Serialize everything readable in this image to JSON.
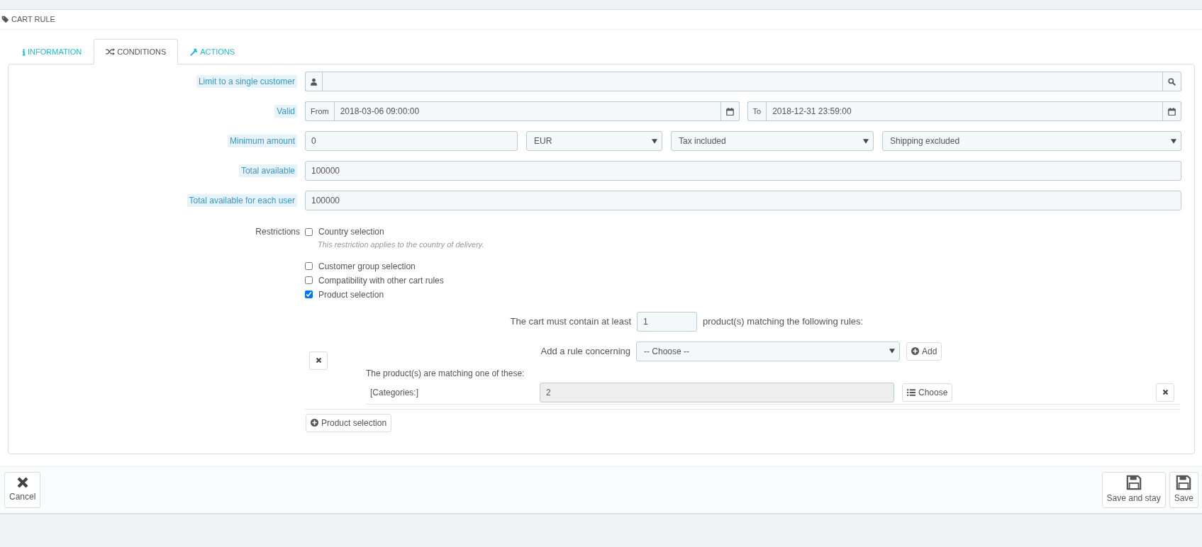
{
  "header": {
    "title": "CART RULE"
  },
  "tabs": [
    {
      "label": "INFORMATION",
      "selected": false
    },
    {
      "label": "CONDITIONS",
      "selected": true
    },
    {
      "label": "ACTIONS",
      "selected": false
    }
  ],
  "form": {
    "customer": {
      "label": "Limit to a single customer"
    },
    "valid": {
      "label": "Valid",
      "from_label": "From",
      "from_value": "2018-03-06 09:00:00",
      "to_label": "To",
      "to_value": "2018-12-31 23:59:00"
    },
    "minimum_amount": {
      "label": "Minimum amount",
      "value": "0",
      "currency": "EUR",
      "tax": "Tax included",
      "shipping": "Shipping excluded"
    },
    "total_available": {
      "label": "Total available",
      "value": "100000"
    },
    "total_per_user": {
      "label": "Total available for each user",
      "value": "100000"
    }
  },
  "restrictions": {
    "label": "Restrictions",
    "options": [
      {
        "label": "Country selection",
        "checked": false,
        "hint": "This restriction applies to the country of delivery."
      },
      {
        "label": "Customer group selection",
        "checked": false
      },
      {
        "label": "Compatibility with other cart rules",
        "checked": false
      },
      {
        "label": "Product selection",
        "checked": true
      }
    ]
  },
  "product_selection": {
    "quantity_before": "The cart must contain at least",
    "quantity": "1",
    "quantity_after": "product(s) matching the following rules:",
    "add_rule_label": "Add a rule concerning",
    "add_rule_choice": "-- Choose --",
    "add_button": "Add",
    "matching_text": "The product(s) are matching one of these:",
    "rules": [
      {
        "label": "[Categories:]",
        "value": "2",
        "choose_button": "Choose"
      }
    ],
    "add_group_button": "Product selection"
  },
  "footer": {
    "buttons": [
      {
        "label": "Cancel",
        "kind": "cancel"
      },
      {
        "label": "Save and stay",
        "kind": "save"
      },
      {
        "label": "Save",
        "kind": "save"
      }
    ]
  }
}
